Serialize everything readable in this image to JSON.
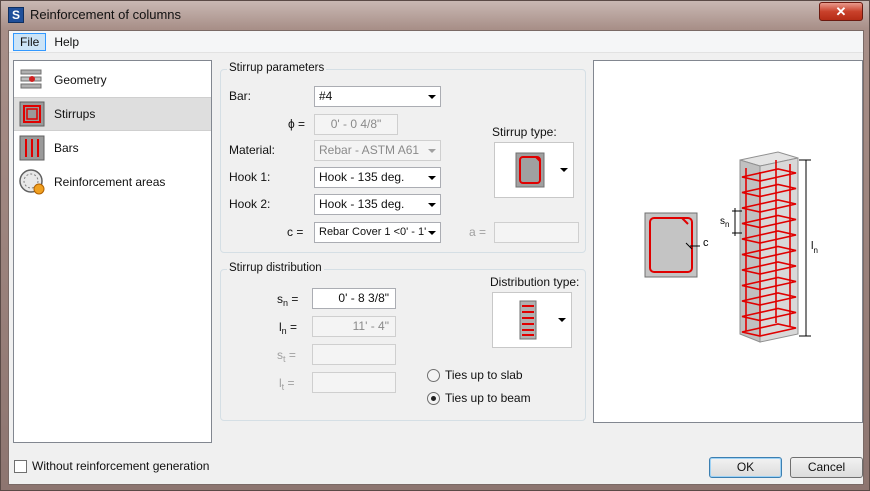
{
  "window": {
    "title": "Reinforcement of columns",
    "close_glyph": "✕",
    "app_icon_letter": "S"
  },
  "menu": [
    {
      "label": "File"
    },
    {
      "label": "Help"
    }
  ],
  "nav": {
    "items": [
      {
        "label": "Geometry",
        "icon": "geometry-icon"
      },
      {
        "label": "Stirrups",
        "icon": "stirrups-icon"
      },
      {
        "label": "Bars",
        "icon": "bars-icon"
      },
      {
        "label": "Reinforcement areas",
        "icon": "reinforcement-areas-icon"
      }
    ],
    "selected_index": 1
  },
  "without_generation": {
    "label": "Without reinforcement generation",
    "checked": false
  },
  "stirrup_params": {
    "title": "Stirrup parameters",
    "bar_label": "Bar:",
    "bar_value": "#4",
    "phi_label": "ϕ =",
    "phi_value": "0' - 0 4/8\"",
    "material_label": "Material:",
    "material_value": "Rebar - ASTM A61",
    "hook1_label": "Hook 1:",
    "hook1_value": "Hook - 135 deg.",
    "hook2_label": "Hook 2:",
    "hook2_value": "Hook - 135 deg.",
    "c_label": "c =",
    "c_value": "Rebar Cover 1 <0' - 1'",
    "a_label": "a =",
    "a_value": "",
    "stirrup_type_label": "Stirrup type:"
  },
  "stirrup_dist": {
    "title": "Stirrup distribution",
    "sn_label": "s",
    "sn_sub": "n",
    "sn_value": "0' - 8 3/8\"",
    "ln_label": "l",
    "ln_sub": "n",
    "ln_value": "11' - 4\"",
    "st_label": "s",
    "st_sub": "t",
    "st_value": "",
    "lt_label": "l",
    "lt_sub": "t",
    "lt_value": "",
    "eq": "=",
    "distribution_type_label": "Distribution type:",
    "radio_slab": "Ties up to slab",
    "radio_beam": "Ties up to beam",
    "selected_radio": "beam"
  },
  "preview": {
    "c_label": "c",
    "sn_label": "s",
    "sn_sub": "n",
    "ln_label": "l",
    "ln_sub": "n"
  },
  "buttons": {
    "ok": "OK",
    "cancel": "Cancel"
  },
  "colors": {
    "rebar": "#e00000",
    "concrete": "#c8c8c8",
    "accent": "#3399ff"
  }
}
